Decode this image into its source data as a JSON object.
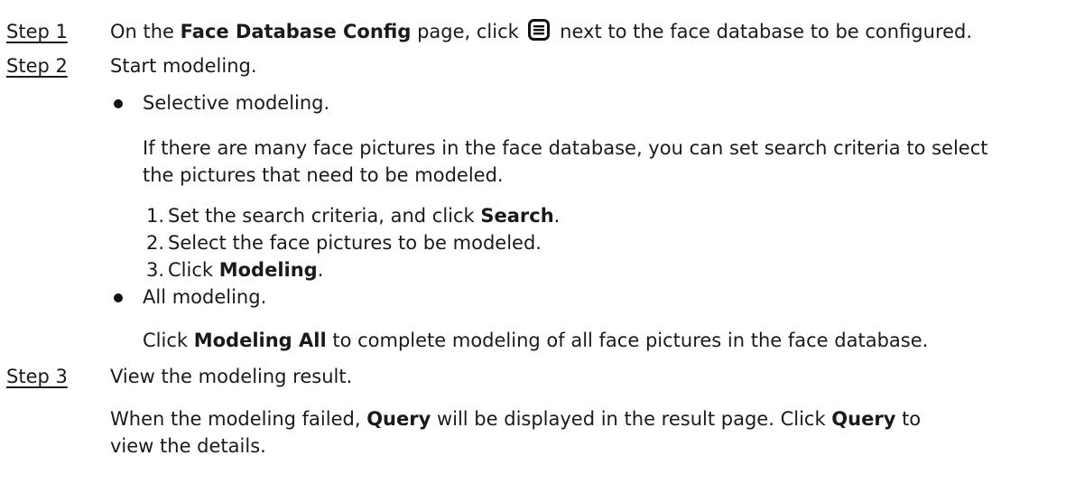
{
  "steps": [
    {
      "label": "Step 1",
      "pre": "On the ",
      "bold": "Face Database Config",
      "mid": " page, click ",
      "icon": "list-detail-icon",
      "post": " next to the face database to be configured."
    },
    {
      "label": "Step 2",
      "text": "Start modeling."
    },
    {
      "label": "Step 3",
      "text": "View the modeling result."
    }
  ],
  "selective": {
    "title": "Selective modeling.",
    "desc_line1": "If there are many face pictures in the face database, you can set search criteria to select",
    "desc_line2": "the pictures that need to be modeled.",
    "substeps": [
      {
        "num": "1.",
        "pre": "Set the search criteria, and click ",
        "bold": "Search",
        "post": "."
      },
      {
        "num": "2.",
        "text": "Select the face pictures to be modeled."
      },
      {
        "num": "3.",
        "pre": "Click ",
        "bold": "Modeling",
        "post": "."
      }
    ]
  },
  "all": {
    "title": "All modeling.",
    "pre": "Click ",
    "bold": "Modeling All",
    "post": " to complete modeling of all face pictures in the face database."
  },
  "result": {
    "pre": "When the modeling failed, ",
    "bold1": "Query",
    "mid": " will be displayed in the result page. Click ",
    "bold2": "Query",
    "post": " to",
    "line2": "view the details."
  }
}
